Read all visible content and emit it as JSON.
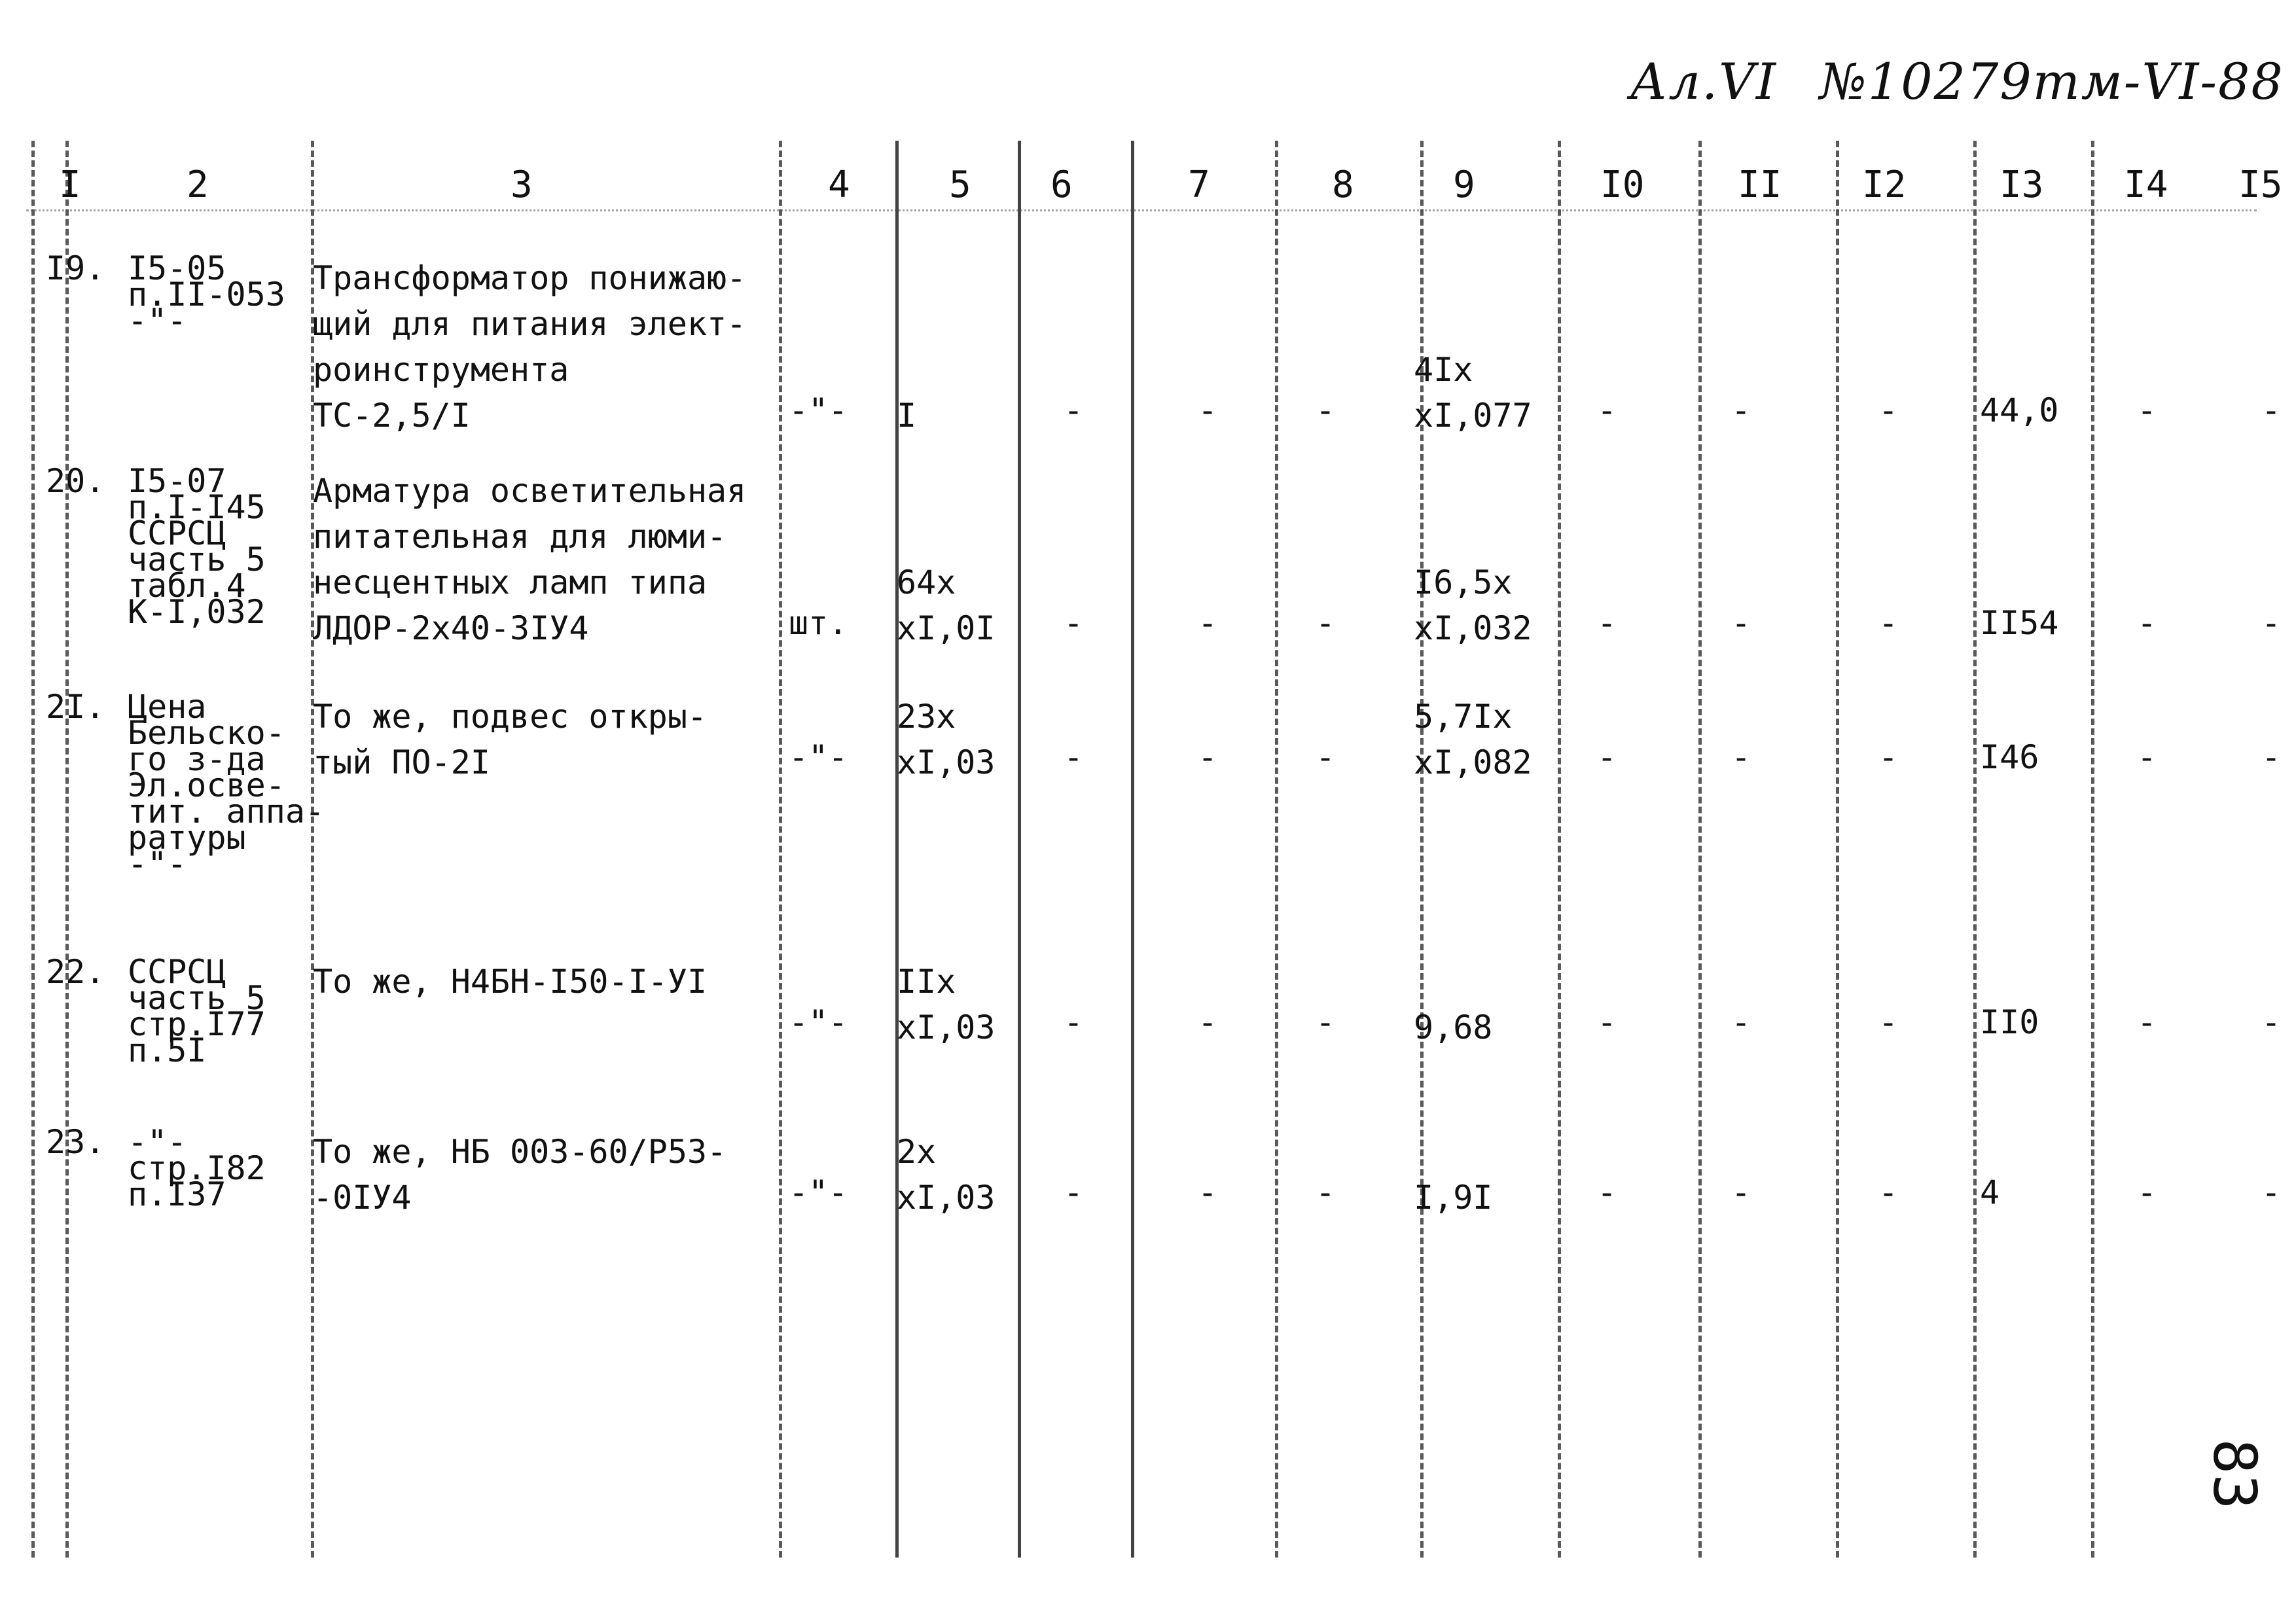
{
  "header": {
    "series": "Ал.VI",
    "number": "№10279тм-VI-88"
  },
  "columns": [
    "I",
    "2",
    "3",
    "4",
    "5",
    "6",
    "7",
    "8",
    "9",
    "I0",
    "II",
    "I2",
    "I3",
    "I4",
    "I5"
  ],
  "rows": [
    {
      "no": "I9.",
      "ref": "I5-05\nп.II-053\n-\"-",
      "name": "Трансформатор понижаю-\nщий для питания элект-\nроинструмента\nТС-2,5/I",
      "unit": "-\"-",
      "c5": "I",
      "c6": "-",
      "c7": "-",
      "c8": "-",
      "c9": "4Ix\nxI,077",
      "c10": "-",
      "c11": "-",
      "c12": "-",
      "c13": "44,0",
      "c14": "-",
      "c15": "-"
    },
    {
      "no": "20.",
      "ref": "I5-07\nп.I-I45\nССРСЦ\nчасть 5\nтабл.4\nК-I,032",
      "name": "Арматура осветительная\nпитательная для люми-\nнесцентных ламп типа\nЛДОР-2х40-3IУ4",
      "unit": "шт.",
      "c5": "64x\nxI,0I",
      "c6": "-",
      "c7": "-",
      "c8": "-",
      "c9": "I6,5x\nxI,032",
      "c10": "-",
      "c11": "-",
      "c12": "-",
      "c13": "II54",
      "c14": "-",
      "c15": "-"
    },
    {
      "no": "2I.",
      "ref": "Цена\nБельско-\nго з-да\nЭл.осве-\nтит. аппа-\nратуры\n-\"-",
      "name": "То же, подвес откры-\nтый ПО-2I",
      "unit": "-\"-",
      "c5": "23x\nxI,03",
      "c6": "-",
      "c7": "-",
      "c8": "-",
      "c9": "5,7Ix\nxI,082",
      "c10": "-",
      "c11": "-",
      "c12": "-",
      "c13": "I46",
      "c14": "-",
      "c15": "-"
    },
    {
      "no": "22.",
      "ref": "ССРСЦ\nчасть 5\nстр.I77\nп.5I",
      "name": "То же, Н4БН-I50-I-УI",
      "unit": "-\"-",
      "c5": "IIx\nxI,03",
      "c6": "-",
      "c7": "-",
      "c8": "-",
      "c9": "9,68",
      "c10": "-",
      "c11": "-",
      "c12": "-",
      "c13": "II0",
      "c14": "-",
      "c15": "-"
    },
    {
      "no": "23.",
      "ref": "-\"-\nстр.I82\nп.I37",
      "name": "То же, НБ 003-60/Р53-\n-0IУ4",
      "unit": "-\"-",
      "c5": "2x\nxI,03",
      "c6": "-",
      "c7": "-",
      "c8": "-",
      "c9": "I,9I",
      "c10": "-",
      "c11": "-",
      "c12": "-",
      "c13": "4",
      "c14": "-",
      "c15": "-"
    }
  ],
  "page_number": "83"
}
